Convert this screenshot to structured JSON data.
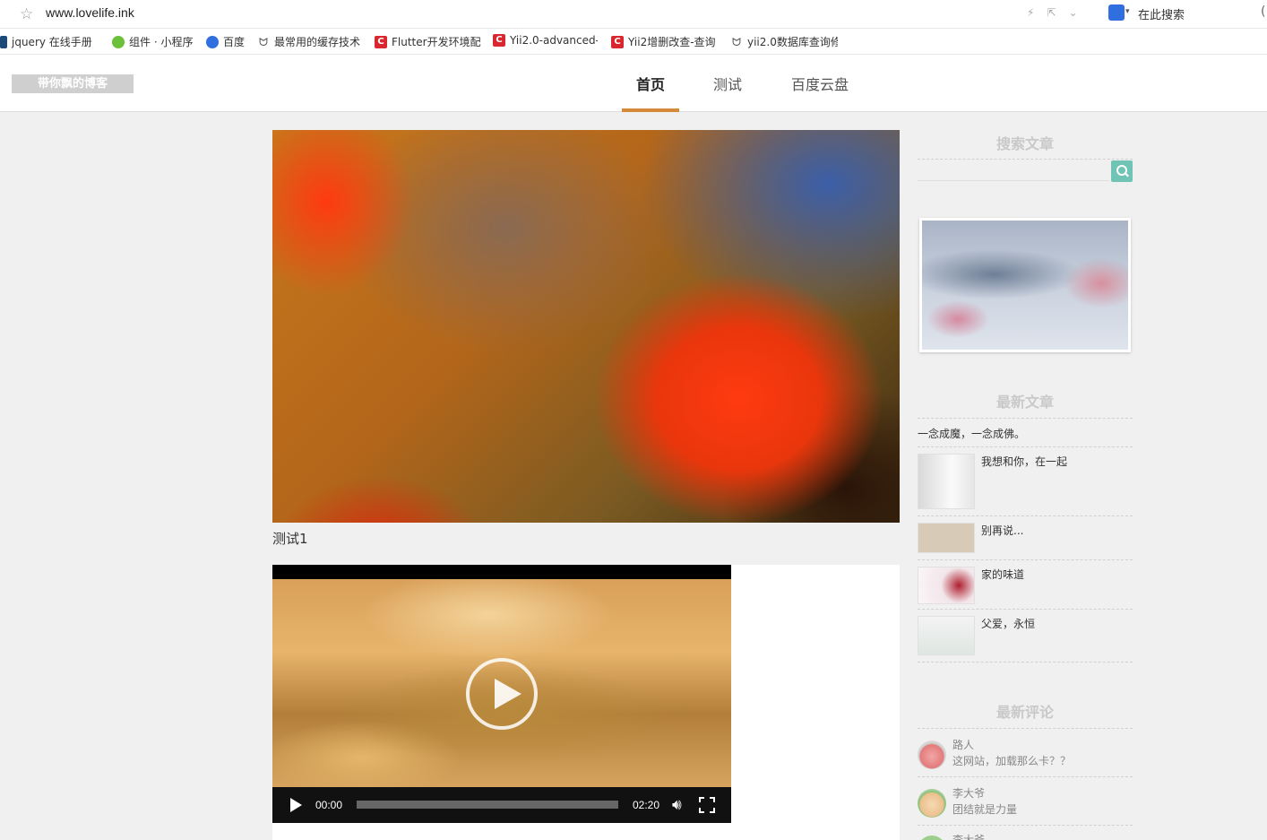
{
  "browser": {
    "url": "www.lovelife.ink",
    "search_placeholder": "在此搜索",
    "bookmarks": [
      {
        "label": "jquery 在线手册"
      },
      {
        "label": "组件 · 小程序"
      },
      {
        "label": "百度"
      },
      {
        "label": "最常用的缓存技术"
      },
      {
        "label": "Flutter开发环境配"
      },
      {
        "label": "Yii2.0-advanced-"
      },
      {
        "label": "Yii2增删改查-查询"
      },
      {
        "label": "yii2.0数据库查询修"
      }
    ]
  },
  "site": {
    "logo": "带你飘的博客",
    "nav": [
      {
        "label": "首页",
        "active": true
      },
      {
        "label": "测试",
        "active": false
      },
      {
        "label": "百度云盘",
        "active": false
      }
    ]
  },
  "main": {
    "hero_caption": "测试1",
    "video": {
      "current_time": "00:00",
      "duration": "02:20",
      "progress": 0
    }
  },
  "sidebar": {
    "search_title": "搜索文章",
    "latest_title": "最新文章",
    "articles": [
      {
        "title": "一念成魔，一念成佛。"
      },
      {
        "title": "我想和你，在一起"
      },
      {
        "title": "别再说..."
      },
      {
        "title": "家的味道"
      },
      {
        "title": "父爱，永恒"
      }
    ],
    "comments_title": "最新评论",
    "comments": [
      {
        "name": "路人",
        "text": "这网站，加载那么卡？？"
      },
      {
        "name": "李大爷",
        "text": "团结就是力量"
      },
      {
        "name": "李大爷",
        "text": ""
      }
    ]
  },
  "colors": {
    "accent": "#d58a3a",
    "search_button": "#6fc4b6",
    "side_title": "#c9c9c9"
  }
}
